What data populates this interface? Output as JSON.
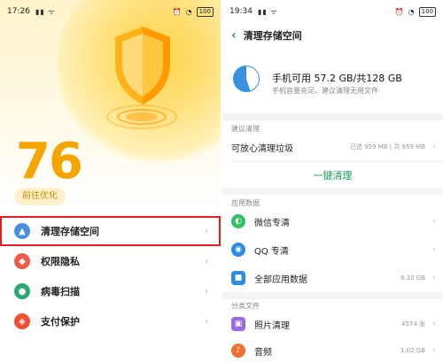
{
  "left": {
    "status": {
      "time": "17:26",
      "battery": "100"
    },
    "score": "76",
    "optimize_label": "前往优化",
    "menu": [
      {
        "label": "清理存储空间",
        "icon": "rocket-icon",
        "color": "#4a8ee6"
      },
      {
        "label": "权限隐私",
        "icon": "shield-key-icon",
        "color": "#ef5a4a"
      },
      {
        "label": "病毒扫描",
        "icon": "virus-scan-icon",
        "color": "#2aa873"
      },
      {
        "label": "支付保护",
        "icon": "payment-shield-icon",
        "color": "#f05030"
      }
    ]
  },
  "right": {
    "status": {
      "time": "19:34",
      "battery": "100"
    },
    "title": "清理存储空间",
    "storage": {
      "summary": "手机可用 57.2 GB/共128 GB",
      "hint": "手机容量充足，建议清理无用文件",
      "used_fraction": 0.55
    },
    "suggest_section": "建议清理",
    "junk": {
      "label": "可放心清理垃圾",
      "value": "已选 959 MB | 共 959 MB"
    },
    "clean_button": "一键清理",
    "apps_section": "应用数据",
    "apps": [
      {
        "label": "微信专清",
        "icon": "wechat-icon",
        "color": "#2dc15f",
        "value": ""
      },
      {
        "label": "QQ 专清",
        "icon": "qq-icon",
        "color": "#2b8be8",
        "value": ""
      },
      {
        "label": "全部应用数据",
        "icon": "cube-icon",
        "color": "#2b8be8",
        "value": "8.32 GB"
      }
    ],
    "files_section": "分类文件",
    "files": [
      {
        "label": "照片清理",
        "icon": "photo-icon",
        "color": "#9a6ae6",
        "value": "4574 张"
      },
      {
        "label": "音频",
        "icon": "audio-icon",
        "color": "#f07030",
        "value": "1.02 GB"
      }
    ]
  },
  "colors": {
    "accent": "#1a9b5c",
    "score": "#f5a500",
    "highlight": "#e02020"
  }
}
